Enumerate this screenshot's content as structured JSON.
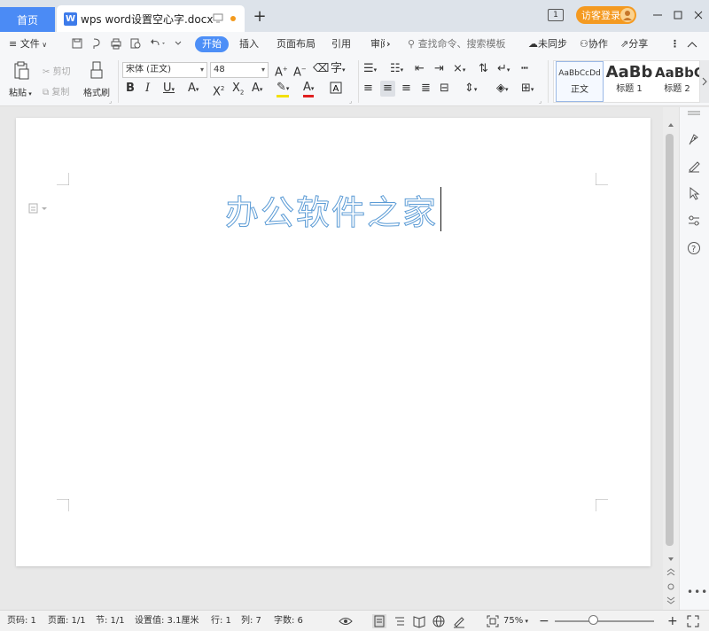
{
  "titlebar": {
    "home_tab": "首页",
    "doc_tab_title": "wps word设置空心字.docx",
    "new_tab": "+",
    "window_count": "1",
    "login_label": "访客登录"
  },
  "menubar": {
    "file": "文件",
    "tabs": [
      "开始",
      "插入",
      "页面布局",
      "引用",
      "审阅"
    ],
    "more": "›",
    "search_placeholder": "查找命令、搜索模板",
    "unsynced": "未同步",
    "collab": "协作",
    "share": "分享"
  },
  "ribbon": {
    "paste": "粘贴",
    "cut": "剪切",
    "copy": "复制",
    "format_painter": "格式刷",
    "font_name": "宋体 (正文)",
    "font_size": "48",
    "styles": [
      {
        "preview": "AaBbCcDd",
        "name": "正文"
      },
      {
        "preview": "AaBb",
        "name": "标题 1"
      },
      {
        "preview": "AaBbC",
        "name": "标题 2"
      }
    ]
  },
  "document": {
    "content": "办公软件之家"
  },
  "statusbar": {
    "page_no": "页码: 1",
    "pages": "页面: 1/1",
    "section": "节: 1/1",
    "setting": "设置值: 3.1厘米",
    "row": "行: 1",
    "col": "列: 7",
    "word_count": "字数: 6",
    "zoom": "75%",
    "zoom_minus": "−",
    "zoom_plus": "+"
  },
  "colors": {
    "accent": "#4d8ff7",
    "login": "#f49a21",
    "outline_text": "#5b9bd5"
  },
  "zoom_level": 0.75
}
